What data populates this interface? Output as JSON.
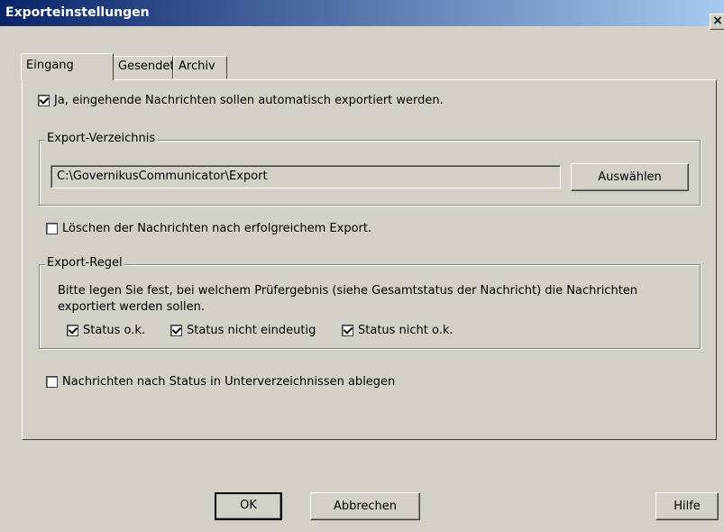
{
  "window": {
    "title": "Exporteinstellungen",
    "close_label": "×"
  },
  "tabs": [
    {
      "label": "Eingang",
      "active": true
    },
    {
      "label": "Gesendete",
      "active": false
    },
    {
      "label": "Archiv",
      "active": false
    }
  ],
  "eingang": {
    "auto_export": {
      "label": "Ja, eingehende Nachrichten sollen automatisch exportiert werden.",
      "checked": true
    },
    "export_dir": {
      "legend": "Export-Verzeichnis",
      "path": "C:\\GovernikusCommunicator\\Export",
      "choose_label": "Auswählen"
    },
    "delete_after": {
      "label": "Löschen der Nachrichten nach erfolgreichem Export.",
      "checked": false
    },
    "export_rule": {
      "legend": "Export-Regel",
      "description": "Bitte legen Sie fest, bei welchem Prüfergebnis (siehe Gesamtstatus der Nachricht) die Nachrichten exportiert werden sollen.",
      "status_ok": {
        "label": "Status o.k.",
        "checked": true
      },
      "status_ambiguous": {
        "label": "Status nicht eindeutig",
        "checked": true
      },
      "status_not_ok": {
        "label": "Status nicht o.k.",
        "checked": true
      }
    },
    "subdirs": {
      "label": "Nachrichten nach Status in Unterverzeichnissen ablegen",
      "checked": false
    }
  },
  "footer": {
    "ok_label": "OK",
    "cancel_label": "Abbrechen",
    "help_label": "Hilfe"
  }
}
